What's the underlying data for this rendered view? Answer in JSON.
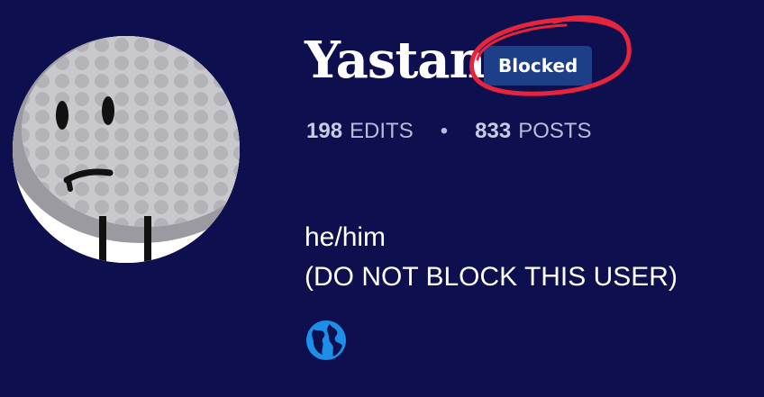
{
  "profile": {
    "username": "Yastan",
    "badge": "Blocked",
    "stats": {
      "edits_count": "198",
      "edits_label": "EDITS",
      "separator": "•",
      "posts_count": "833",
      "posts_label": "POSTS"
    },
    "bio": {
      "line1": "he/him",
      "line2": "(DO NOT BLOCK THIS USER)"
    },
    "avatar_icon": "golf-ball-character",
    "website_icon": "globe-icon"
  },
  "colors": {
    "background": "#0d0f4f",
    "badge_background": "#1c3f88",
    "annotation_circle": "#e8243a",
    "globe": "#1e8fe8",
    "stats_text": "#b9bcd8"
  }
}
